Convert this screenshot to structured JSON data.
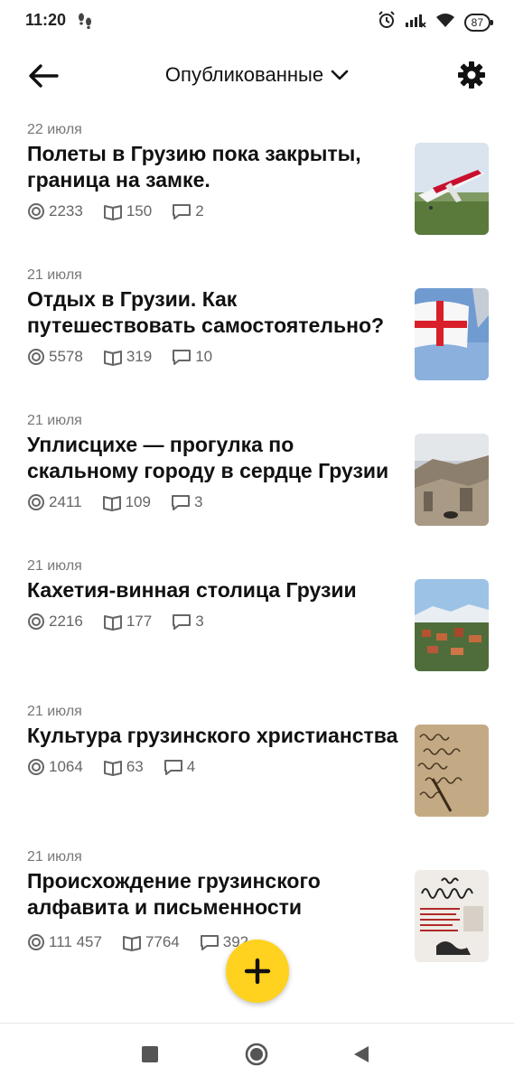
{
  "status_bar": {
    "time": "11:20",
    "battery": "87",
    "icons": [
      "steps-icon",
      "alarm-icon",
      "signal-icon",
      "wifi-icon",
      "battery-icon"
    ]
  },
  "header": {
    "title": "Опубликованные",
    "back_icon": "arrow-left-icon",
    "dropdown_icon": "chevron-down-icon",
    "settings_icon": "gear-icon"
  },
  "articles": [
    {
      "date": "22 июля",
      "title": "Полеты в Грузию пока закрыты, граница на замке.",
      "views": "2233",
      "reads": "150",
      "comments": "2"
    },
    {
      "date": "21 июля",
      "title": "Отдых в Грузии. Как путешествовать самостоятельно?",
      "views": "5578",
      "reads": "319",
      "comments": "10"
    },
    {
      "date": "21 июля",
      "title": "Уплисцихе — прогулка по скальному городу в сердце Грузии",
      "views": "2411",
      "reads": "109",
      "comments": "3"
    },
    {
      "date": "21 июля",
      "title": "Кахетия-винная столица Грузии",
      "views": "2216",
      "reads": "177",
      "comments": "3"
    },
    {
      "date": "21 июля",
      "title": "Культура грузинского христианства",
      "views": "1064",
      "reads": "63",
      "comments": "4"
    },
    {
      "date": "21 июля",
      "title": "Происхождение грузинского алфавита и письменности",
      "views": "111 457",
      "reads": "7764",
      "comments": "392"
    }
  ],
  "fab": {
    "icon": "plus-icon"
  },
  "nav_bar": {
    "icons": [
      "recents-square-icon",
      "home-circle-icon",
      "back-triangle-icon"
    ]
  },
  "colors": {
    "accent": "#ffd21f",
    "text": "#111111",
    "muted": "#777777"
  }
}
